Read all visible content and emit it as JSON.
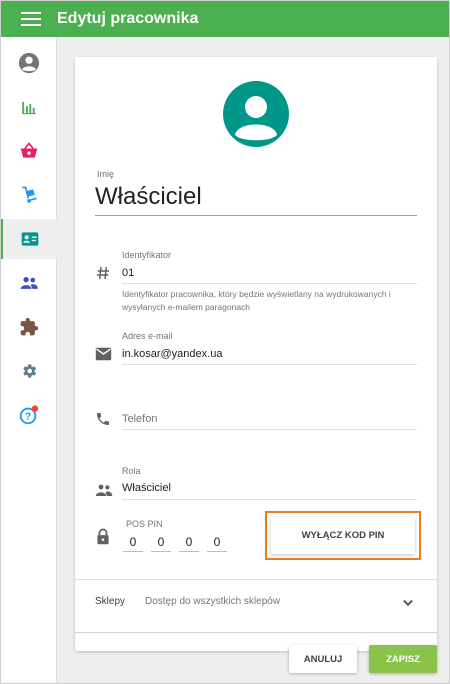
{
  "header": {
    "title": "Edytuj pracownika",
    "bg_color": "#4caf50"
  },
  "sidebar": {
    "items": [
      {
        "icon": "account-circle-icon",
        "active": false
      },
      {
        "icon": "bar-chart-icon",
        "active": false
      },
      {
        "icon": "basket-icon",
        "active": false
      },
      {
        "icon": "hand-truck-icon",
        "active": false
      },
      {
        "icon": "badge-card-icon",
        "active": true
      },
      {
        "icon": "people-icon",
        "active": false
      },
      {
        "icon": "puzzle-icon",
        "active": false
      },
      {
        "icon": "gear-icon",
        "active": false
      },
      {
        "icon": "help-icon",
        "active": false,
        "badge": true
      }
    ]
  },
  "form": {
    "name_label": "Imię",
    "name_value": "Właściciel",
    "identifier": {
      "label": "Identyfikator",
      "value": "01",
      "hint": "Identyfikator pracownika, który będzie wyświetlany na wydrukowanych i wysyłanych e-mailem paragonach"
    },
    "email": {
      "label": "Adres e-mail",
      "value": "in.kosar@yandex.ua"
    },
    "phone": {
      "placeholder": "Telefon"
    },
    "role": {
      "label": "Rola",
      "value": "Właściciel"
    },
    "pos_pin": {
      "label": "POS PIN",
      "digits": [
        "0",
        "0",
        "0",
        "0"
      ],
      "disable_button": "WYŁĄCZ KOD PIN"
    },
    "shops": {
      "label": "Sklepy",
      "value": "Dostęp do wszystkich sklepów"
    }
  },
  "actions": {
    "cancel": "ANULUJ",
    "save": "ZAPISZ"
  },
  "colors": {
    "accent": "#4caf50",
    "avatar": "#009688",
    "save": "#8bc34a",
    "highlight": "#e67e22"
  }
}
